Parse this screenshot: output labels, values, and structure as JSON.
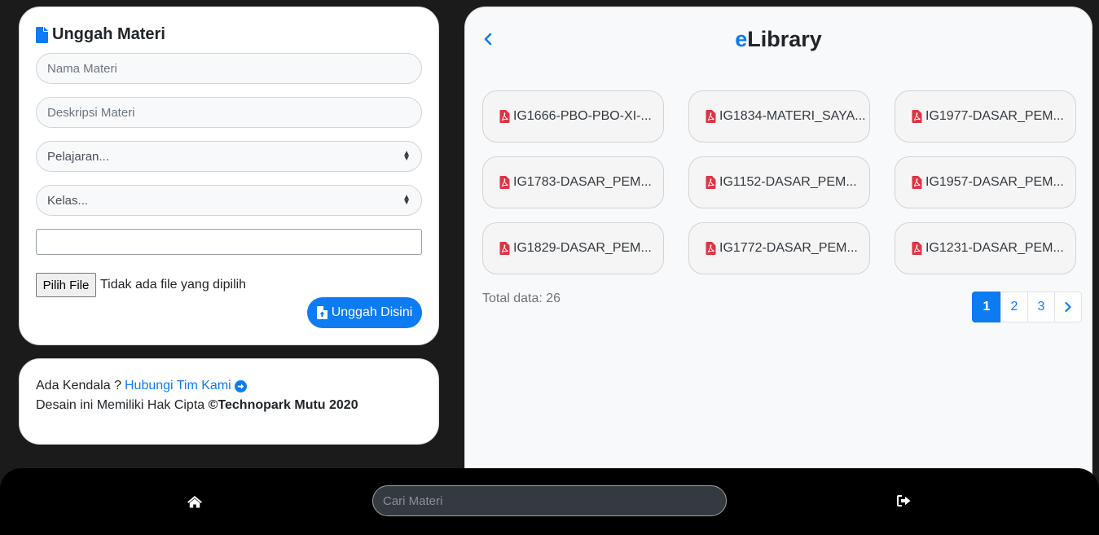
{
  "upload": {
    "title": "Unggah Materi",
    "name_placeholder": "Nama Materi",
    "description_placeholder": "Deskripsi Materi",
    "subject_selected": "Pelajaran...",
    "class_selected": "Kelas...",
    "text_field_value": "",
    "choose_file_label": "Pilih File",
    "file_status": "Tidak ada file yang dipilih",
    "submit_label": "Unggah Disini"
  },
  "footer": {
    "question": "Ada Kendala ?",
    "contact_link": "Hubungi Tim Kami",
    "copyright_prefix": "Desain ini Memiliki Hak Cipta",
    "copyright_owner": "©Technopark Mutu 2020"
  },
  "library": {
    "title_accent": "e",
    "title_rest": "Library",
    "files": [
      "IG1666-PBO-PBO-XI-...",
      "IG1834-MATERI_SAYA...",
      "IG1977-DASAR_PEM...",
      "IG1783-DASAR_PEM...",
      "IG1152-DASAR_PEM...",
      "IG1957-DASAR_PEM...",
      "IG1829-DASAR_PEM...",
      "IG1772-DASAR_PEM...",
      "IG1231-DASAR_PEM..."
    ],
    "total_label": "Total data: 26",
    "pages": [
      "1",
      "2",
      "3"
    ],
    "current_page": "1"
  },
  "bottom_bar": {
    "search_placeholder": "Cari Materi"
  },
  "icons": {
    "upload_title": "file-icon",
    "file_items": "pdf-icon",
    "contact_link": "arrow-circle-right-icon",
    "back": "chevron-left-icon",
    "next_page": "chevron-right-icon",
    "home": "home-icon",
    "logout": "logout-icon",
    "submit": "file-upload-icon"
  },
  "colors": {
    "accent": "#0d7bf2",
    "pdf": "#dc3545",
    "page_background": "#1b1b1b",
    "bottom_bar": "#000000"
  }
}
